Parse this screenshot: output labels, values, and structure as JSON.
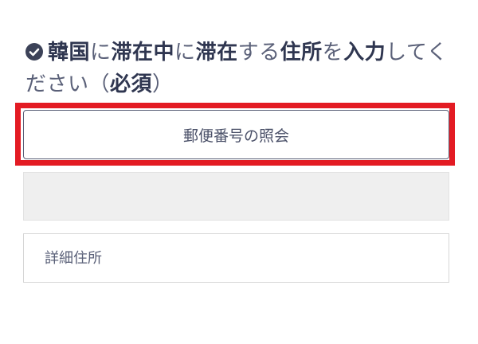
{
  "question": {
    "icon": "check-circle-icon",
    "segments": [
      {
        "text": "韓国",
        "bold": true
      },
      {
        "text": "に",
        "bold": false
      },
      {
        "text": "滞在中",
        "bold": true
      },
      {
        "text": "に",
        "bold": false
      },
      {
        "text": "滞在",
        "bold": true
      },
      {
        "text": "する",
        "bold": false
      },
      {
        "text": "住所",
        "bold": true
      },
      {
        "text": "を",
        "bold": false
      },
      {
        "text": "入力",
        "bold": true
      },
      {
        "text": "してください（",
        "bold": false
      },
      {
        "text": "必須",
        "bold": true
      },
      {
        "text": "）",
        "bold": false
      }
    ]
  },
  "postal_lookup": {
    "label": "郵便番号の照会"
  },
  "address": {
    "value": ""
  },
  "detail_address": {
    "placeholder": "詳細住所",
    "value": ""
  },
  "colors": {
    "highlight": "#e31b23",
    "text": "#3c4258",
    "readonly_bg": "#efefef"
  }
}
